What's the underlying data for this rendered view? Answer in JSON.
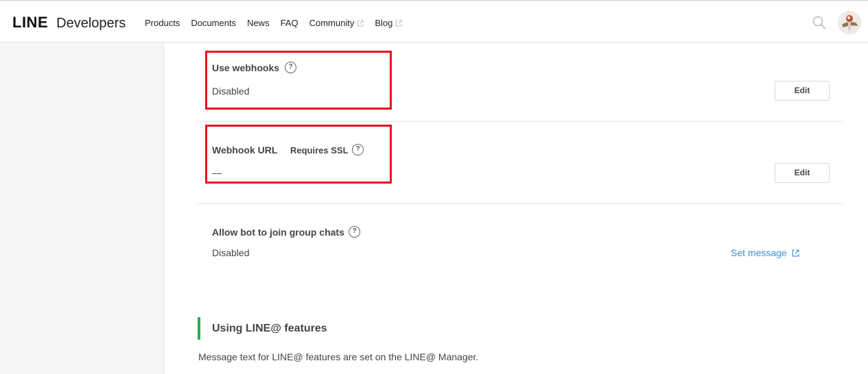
{
  "header": {
    "logo_line": "LINE",
    "logo_developers": "Developers",
    "nav": [
      {
        "label": "Products",
        "external": false
      },
      {
        "label": "Documents",
        "external": false
      },
      {
        "label": "News",
        "external": false
      },
      {
        "label": "FAQ",
        "external": false
      },
      {
        "label": "Community",
        "external": true
      },
      {
        "label": "Blog",
        "external": true
      }
    ]
  },
  "settings": {
    "webhooks": {
      "label": "Use webhooks",
      "value": "Disabled",
      "button": "Edit"
    },
    "webhook_url": {
      "label": "Webhook URL",
      "sublabel": "Requires SSL",
      "value": "—",
      "button": "Edit"
    },
    "group_chats": {
      "label": "Allow bot to join group chats",
      "value": "Disabled",
      "link": "Set message"
    }
  },
  "section": {
    "title": "Using LINE@ features",
    "description": "Message text for LINE@ features are set on the LINE@ Manager."
  },
  "colors": {
    "highlight": "#e5141c",
    "accent_green": "#22b14c",
    "link_blue": "#3d8ed6"
  }
}
